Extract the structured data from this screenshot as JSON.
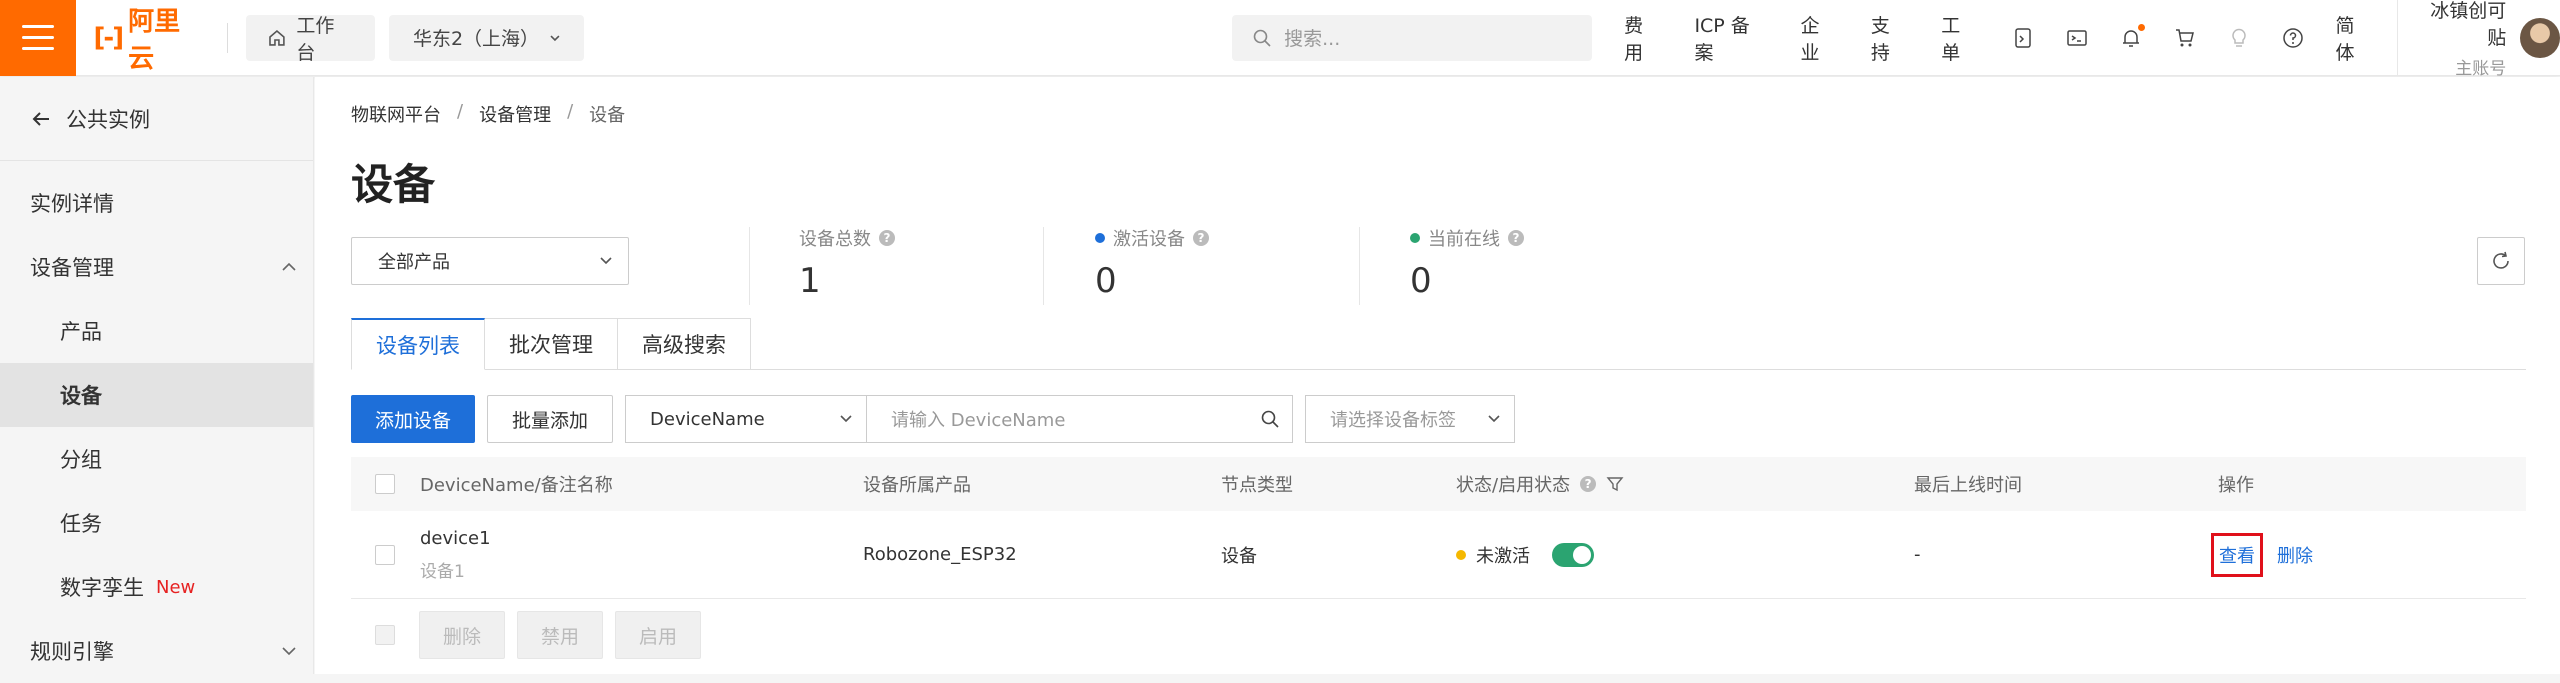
{
  "topbar": {
    "logo_text": "阿里云",
    "workbench": "工作台",
    "region": "华东2（上海）",
    "search_placeholder": "搜索...",
    "links": [
      "费用",
      "ICP 备案",
      "企业",
      "支持",
      "工单"
    ],
    "lang": "简体",
    "account_name": "冰镇创可贴",
    "account_type": "主账号",
    "brand_color": "#ff6a00"
  },
  "sidebar": {
    "back": "公共实例",
    "items": [
      {
        "label": "实例详情"
      },
      {
        "label": "设备管理"
      },
      {
        "label": "产品"
      },
      {
        "label": "设备"
      },
      {
        "label": "分组"
      },
      {
        "label": "任务"
      },
      {
        "label": "数字孪生",
        "tag": "New"
      },
      {
        "label": "规则引擎"
      }
    ]
  },
  "breadcrumb": [
    "物联网平台",
    "设备管理",
    "设备"
  ],
  "page_title": "设备",
  "product_select": "全部产品",
  "stats": [
    {
      "label": "设备总数",
      "value": "1"
    },
    {
      "label": "激活设备",
      "value": "0",
      "color": "#1e6fd9"
    },
    {
      "label": "当前在线",
      "value": "0",
      "color": "#2ba471"
    }
  ],
  "tabs": [
    "设备列表",
    "批次管理",
    "高级搜索"
  ],
  "toolbar": {
    "add": "添加设备",
    "batch_add": "批量添加",
    "field_select": "DeviceName",
    "search_placeholder": "请输入 DeviceName",
    "tag_placeholder": "请选择设备标签"
  },
  "table": {
    "headers": [
      "DeviceName/备注名称",
      "设备所属产品",
      "节点类型",
      "状态/启用状态",
      "最后上线时间",
      "操作"
    ],
    "rows": [
      {
        "name": "device1",
        "note": "设备1",
        "product": "Robozone_ESP32",
        "node_type": "设备",
        "status": "未激活",
        "status_color": "#f5b800",
        "enabled": true,
        "last_online": "-",
        "actions": [
          "查看",
          "删除"
        ]
      }
    ]
  },
  "bulk_actions": [
    "删除",
    "禁用",
    "启用"
  ]
}
